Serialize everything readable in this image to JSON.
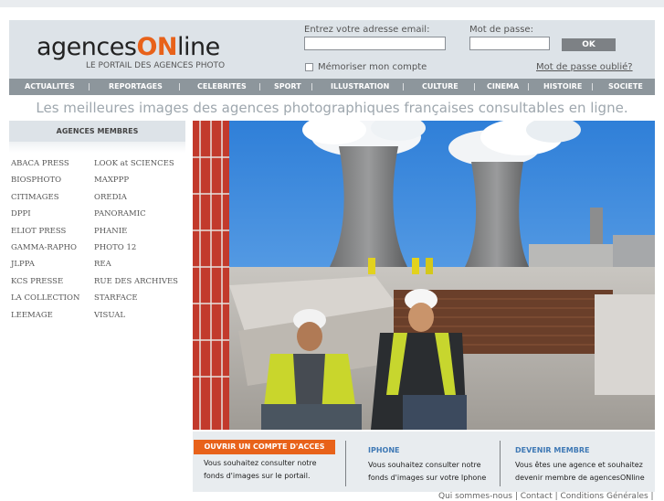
{
  "header": {
    "logo_prefix": "agences",
    "logo_on": "ON",
    "logo_suffix": "line",
    "logo_subtitle": "LE PORTAIL DES AGENCES PHOTO",
    "email_label": "Entrez votre adresse email:",
    "email_value": "",
    "password_label": "Mot de passe:",
    "password_value": "",
    "ok_label": "OK",
    "remember_label": "Mémoriser mon compte",
    "remember_checked": false,
    "forgot_label": "Mot de passe oublié?"
  },
  "nav": {
    "items": [
      "ACTUALITES",
      "REPORTAGES",
      "CELEBRITES",
      "SPORT",
      "ILLUSTRATION",
      "CULTURE",
      "CINEMA",
      "HISTOIRE",
      "SOCIETE"
    ],
    "separator": "|"
  },
  "tagline": "Les meilleures images des agences photographiques françaises consultables en ligne.",
  "members": {
    "title": "AGENCES MEMBRES",
    "col1": [
      "ABACA PRESS",
      "BIOSPHOTO",
      "CITIMAGES",
      "DPPI",
      "ELIOT PRESS",
      "GAMMA-RAPHO",
      "JLPPA",
      "KCS PRESSE",
      "LA COLLECTION",
      "LEEMAGE"
    ],
    "col2": [
      "LOOK at SCIENCES",
      "MAXPPP",
      "OREDIA",
      "PANORAMIC",
      "PHANIE",
      "PHOTO 12",
      "REA",
      "RUE DES ARCHIVES",
      "STARFACE",
      "VISUAL"
    ]
  },
  "bottom": {
    "account_button": "OUVRIR UN COMPTE D'ACCES",
    "account_line1": "Vous souhaitez consulter notre",
    "account_line2": "fonds d'images sur le portail.",
    "iphone_title": "IPHONE",
    "iphone_line1": "Vous souhaitez consulter notre",
    "iphone_line2": "fonds d'images sur votre Iphone",
    "member_title": "DEVENIR MEMBRE",
    "member_line1": "Vous êtes une agence et souhaitez",
    "member_line2": "devenir membre de agencesONline"
  },
  "footer": "Qui sommes-nous | Contact | Conditions Générales |",
  "colors": {
    "accent_orange": "#e8621a",
    "nav_bg": "#8d969c",
    "header_bg": "#dde3e8",
    "link_blue": "#3f79b5"
  }
}
